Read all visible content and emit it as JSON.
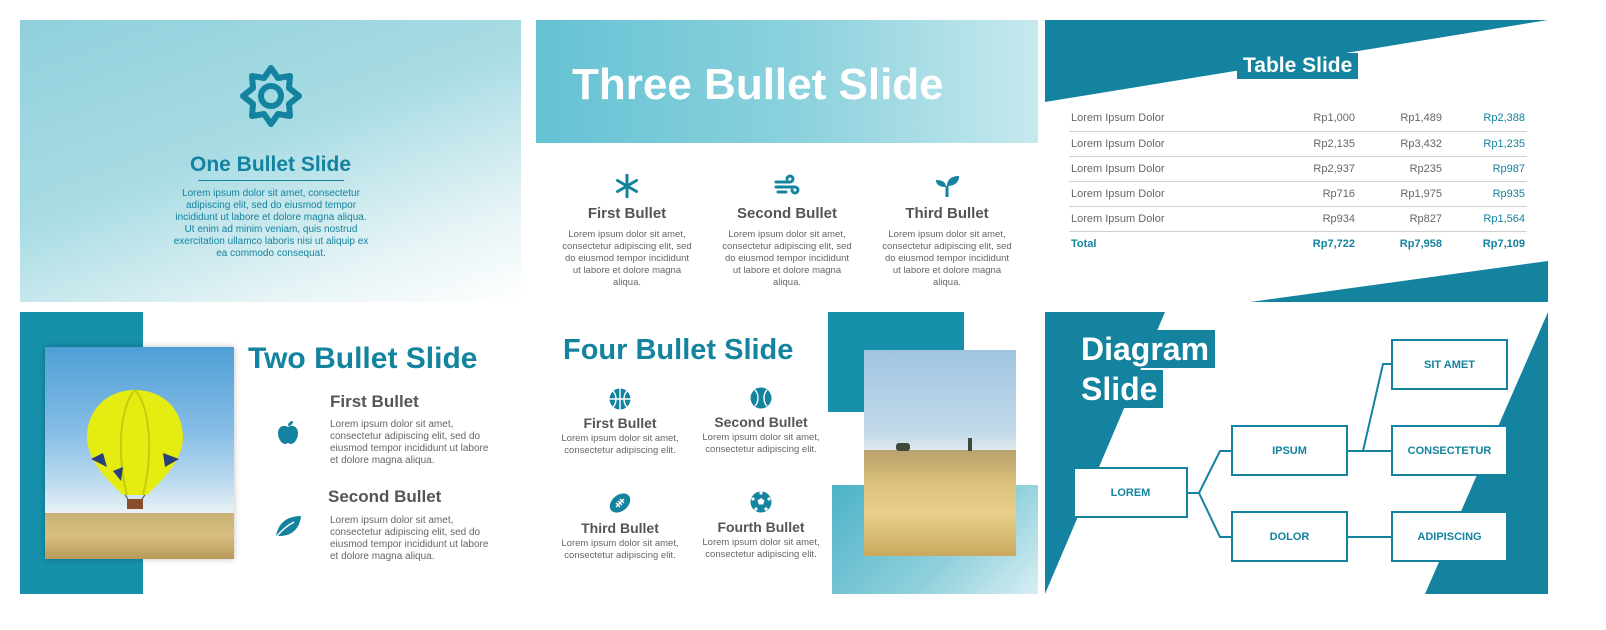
{
  "one_bullet": {
    "title": "One Bullet Slide",
    "icon": "gear-icon",
    "body": "Lorem ipsum dolor sit amet, consectetur adipiscing elit, sed do eiusmod tempor incididunt ut labore et dolore magna aliqua. Ut enim ad minim veniam, quis nostrud exercitation ullamco laboris nisi ut aliquip ex ea commodo consequat."
  },
  "three_bullet": {
    "title": "Three Bullet Slide",
    "bullets": [
      {
        "icon": "snowflake-icon",
        "heading": "First Bullet",
        "text": "Lorem ipsum dolor sit amet, consectetur adipiscing elit, sed do eiusmod tempor incididunt ut labore et dolore magna aliqua."
      },
      {
        "icon": "wind-icon",
        "heading": "Second Bullet",
        "text": "Lorem ipsum dolor sit amet, consectetur adipiscing elit, sed do eiusmod tempor incididunt ut labore et dolore magna aliqua."
      },
      {
        "icon": "sprout-icon",
        "heading": "Third Bullet",
        "text": "Lorem ipsum dolor sit amet, consectetur adipiscing elit, sed do eiusmod tempor incididunt ut labore et dolore magna aliqua."
      }
    ]
  },
  "table_slide": {
    "title": "Table Slide",
    "rows": [
      [
        "Lorem Ipsum Dolor",
        "Rp1,000",
        "Rp1,489",
        "Rp2,388"
      ],
      [
        "Lorem Ipsum Dolor",
        "Rp2,135",
        "Rp3,432",
        "Rp1,235"
      ],
      [
        "Lorem Ipsum Dolor",
        "Rp2,937",
        "Rp235",
        "Rp987"
      ],
      [
        "Lorem Ipsum Dolor",
        "Rp716",
        "Rp1,975",
        "Rp935"
      ],
      [
        "Lorem Ipsum Dolor",
        "Rp934",
        "Rp827",
        "Rp1,564"
      ]
    ],
    "total": [
      "Total",
      "Rp7,722",
      "Rp7,958",
      "Rp7,109"
    ]
  },
  "two_bullet": {
    "title": "Two Bullet Slide",
    "image": "hot-air-balloon-photo",
    "bullets": [
      {
        "icon": "apple-icon",
        "heading": "First Bullet",
        "text": "Lorem ipsum dolor sit amet, consectetur adipiscing elit, sed do eiusmod tempor incididunt ut labore et dolore magna aliqua."
      },
      {
        "icon": "leaf-icon",
        "heading": "Second Bullet",
        "text": "Lorem ipsum dolor sit amet, consectetur adipiscing elit, sed do eiusmod tempor incididunt ut labore et dolore magna aliqua."
      }
    ]
  },
  "four_bullet": {
    "title": "Four Bullet Slide",
    "image": "wheat-field-photo",
    "bullets": [
      {
        "icon": "basketball-icon",
        "heading": "First Bullet",
        "text": "Lorem ipsum dolor sit amet, consectetur adipiscing elit."
      },
      {
        "icon": "baseball-icon",
        "heading": "Second Bullet",
        "text": "Lorem ipsum dolor sit amet, consectetur adipiscing elit."
      },
      {
        "icon": "football-icon",
        "heading": "Third Bullet",
        "text": "Lorem ipsum dolor sit amet, consectetur adipiscing elit."
      },
      {
        "icon": "soccer-ball-icon",
        "heading": "Fourth Bullet",
        "text": "Lorem ipsum dolor sit amet, consectetur adipiscing elit."
      }
    ]
  },
  "diagram": {
    "title_line1": "Diagram",
    "title_line2": "Slide",
    "nodes": {
      "root": "LOREM",
      "mid_top": "IPSUM",
      "mid_bottom": "DOLOR",
      "leaf1": "SIT AMET",
      "leaf2": "CONSECTETUR",
      "leaf3": "ADIPISCING"
    }
  },
  "colors": {
    "accent": "#13839f",
    "sky": "#8fd0dc",
    "text": "#555555"
  }
}
